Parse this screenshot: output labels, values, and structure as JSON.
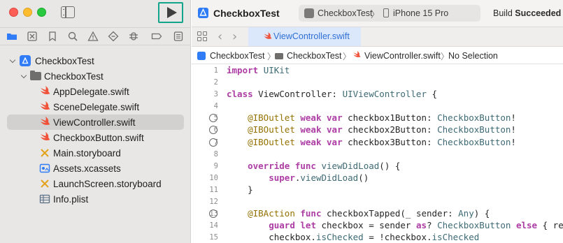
{
  "window": {
    "traffic_lights": [
      "close",
      "minimize",
      "zoom"
    ],
    "colors": {
      "close": "#fe5f57",
      "minimize": "#febc2e",
      "zoom": "#28c840",
      "run_highlight": "#12a58a",
      "accent": "#2f7cf6"
    }
  },
  "navigator": {
    "icons": [
      "folder-icon",
      "source-control-icon",
      "bookmark-icon",
      "find-icon",
      "issue-icon",
      "test-icon",
      "debug-icon",
      "breakpoint-icon",
      "report-icon"
    ],
    "tree": [
      {
        "label": "CheckboxTest",
        "icon": "app-icon",
        "level": 0,
        "disclosure": true
      },
      {
        "label": "CheckboxTest",
        "icon": "folder-icon",
        "level": 1,
        "disclosure": true
      },
      {
        "label": "AppDelegate.swift",
        "icon": "swift-icon",
        "level": 2
      },
      {
        "label": "SceneDelegate.swift",
        "icon": "swift-icon",
        "level": 2
      },
      {
        "label": "ViewController.swift",
        "icon": "swift-icon",
        "level": 2,
        "selected": true
      },
      {
        "label": "CheckboxButton.swift",
        "icon": "swift-icon",
        "level": 2
      },
      {
        "label": "Main.storyboard",
        "icon": "storyboard-icon",
        "level": 2
      },
      {
        "label": "Assets.xcassets",
        "icon": "assets-icon",
        "level": 2
      },
      {
        "label": "LaunchScreen.storyboard",
        "icon": "storyboard-icon",
        "level": 2
      },
      {
        "label": "Info.plist",
        "icon": "plist-icon",
        "level": 2
      }
    ]
  },
  "toolbar": {
    "project_title": "CheckboxTest",
    "scheme": "CheckboxTest",
    "device": "iPhone 15 Pro",
    "build_prefix": "Build",
    "build_state": "Succeeded"
  },
  "tabs": {
    "active": "ViewController.swift"
  },
  "jumpbar": {
    "project": "CheckboxTest",
    "group": "CheckboxTest",
    "file": "ViewController.swift",
    "selection": "No Selection"
  },
  "code": {
    "lines": [
      {
        "n": "1",
        "text": "import UIKit"
      },
      {
        "n": "2",
        "text": ""
      },
      {
        "n": "3",
        "text": "class ViewController: UIViewController {"
      },
      {
        "n": "4",
        "text": ""
      },
      {
        "n": "5",
        "text": "    @IBOutlet weak var checkbox1Button: CheckboxButton!",
        "bp": true
      },
      {
        "n": "6",
        "text": "    @IBOutlet weak var checkbox2Button: CheckboxButton!",
        "bp": true
      },
      {
        "n": "7",
        "text": "    @IBOutlet weak var checkbox3Button: CheckboxButton!",
        "bp": true
      },
      {
        "n": "8",
        "text": ""
      },
      {
        "n": "9",
        "text": "    override func viewDidLoad() {"
      },
      {
        "n": "10",
        "text": "        super.viewDidLoad()"
      },
      {
        "n": "11",
        "text": "    }"
      },
      {
        "n": "12",
        "text": ""
      },
      {
        "n": "13",
        "text": "    @IBAction func checkboxTapped(_ sender: Any) {",
        "bp": true
      },
      {
        "n": "14",
        "text": "        guard let checkbox = sender as? CheckboxButton else { ret"
      },
      {
        "n": "15",
        "text": "        checkbox.isChecked = !checkbox.isChecked"
      }
    ]
  }
}
